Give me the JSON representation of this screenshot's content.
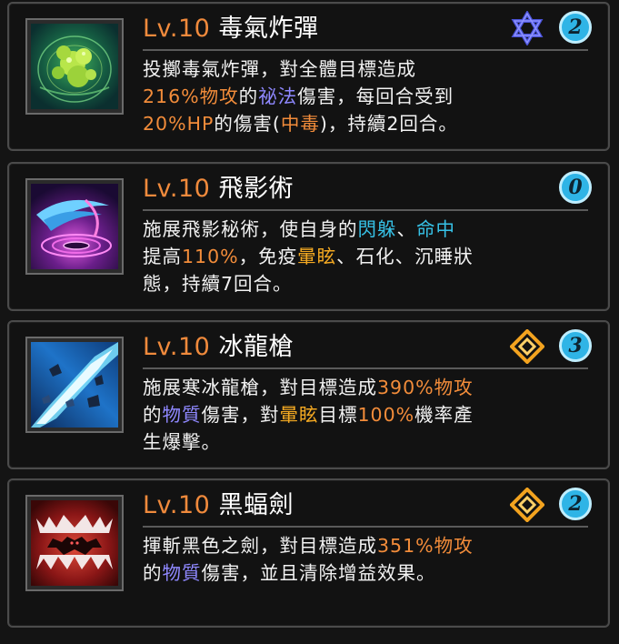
{
  "skills": [
    {
      "level": "Lv.10",
      "name": "毒氣炸彈",
      "cooldown": "2",
      "type_icon": "hexagram-icon",
      "thumb_icon": "poison-bomb-icon",
      "desc": [
        [
          {
            "t": "投擲毒氣炸彈，對全體目標造成"
          }
        ],
        [
          {
            "t": "216%物攻",
            "c": "o"
          },
          {
            "t": "的"
          },
          {
            "t": "祕法",
            "c": "b"
          },
          {
            "t": "傷害，每回合受到"
          }
        ],
        [
          {
            "t": "20%HP",
            "c": "o"
          },
          {
            "t": "的傷害("
          },
          {
            "t": "中毒",
            "c": "o"
          },
          {
            "t": ")，持續2回合。"
          }
        ]
      ]
    },
    {
      "level": "Lv.10",
      "name": "飛影術",
      "cooldown": "0",
      "type_icon": "",
      "thumb_icon": "shadow-vortex-icon",
      "desc": [
        [
          {
            "t": "施展飛影秘術，使自身的"
          },
          {
            "t": "閃躲",
            "c": "c"
          },
          {
            "t": "、"
          },
          {
            "t": "命中",
            "c": "c"
          }
        ],
        [
          {
            "t": "提高"
          },
          {
            "t": "110%",
            "c": "o"
          },
          {
            "t": "，免疫"
          },
          {
            "t": "暈眩",
            "c": "y"
          },
          {
            "t": "、石化、沉睡狀"
          }
        ],
        [
          {
            "t": "態，持續7回合。"
          }
        ]
      ]
    },
    {
      "level": "Lv.10",
      "name": "冰龍槍",
      "cooldown": "3",
      "type_icon": "diamond-icon",
      "thumb_icon": "ice-spear-icon",
      "desc": [
        [
          {
            "t": "施展寒冰龍槍，對目標造成"
          },
          {
            "t": "390%物攻",
            "c": "o"
          }
        ],
        [
          {
            "t": "的"
          },
          {
            "t": "物質",
            "c": "b"
          },
          {
            "t": "傷害，對"
          },
          {
            "t": "暈眩",
            "c": "y"
          },
          {
            "t": "目標"
          },
          {
            "t": "100%",
            "c": "o"
          },
          {
            "t": "機率產"
          }
        ],
        [
          {
            "t": "生爆擊。"
          }
        ]
      ]
    },
    {
      "level": "Lv.10",
      "name": "黑蝠劍",
      "cooldown": "2",
      "type_icon": "diamond-icon",
      "thumb_icon": "bat-sword-icon",
      "desc": [
        [
          {
            "t": "揮斬黑色之劍，對目標造成"
          },
          {
            "t": "351%物攻",
            "c": "o"
          }
        ],
        [
          {
            "t": "的"
          },
          {
            "t": "物質",
            "c": "b"
          },
          {
            "t": "傷害，並且清除增益效果。"
          }
        ]
      ]
    }
  ]
}
